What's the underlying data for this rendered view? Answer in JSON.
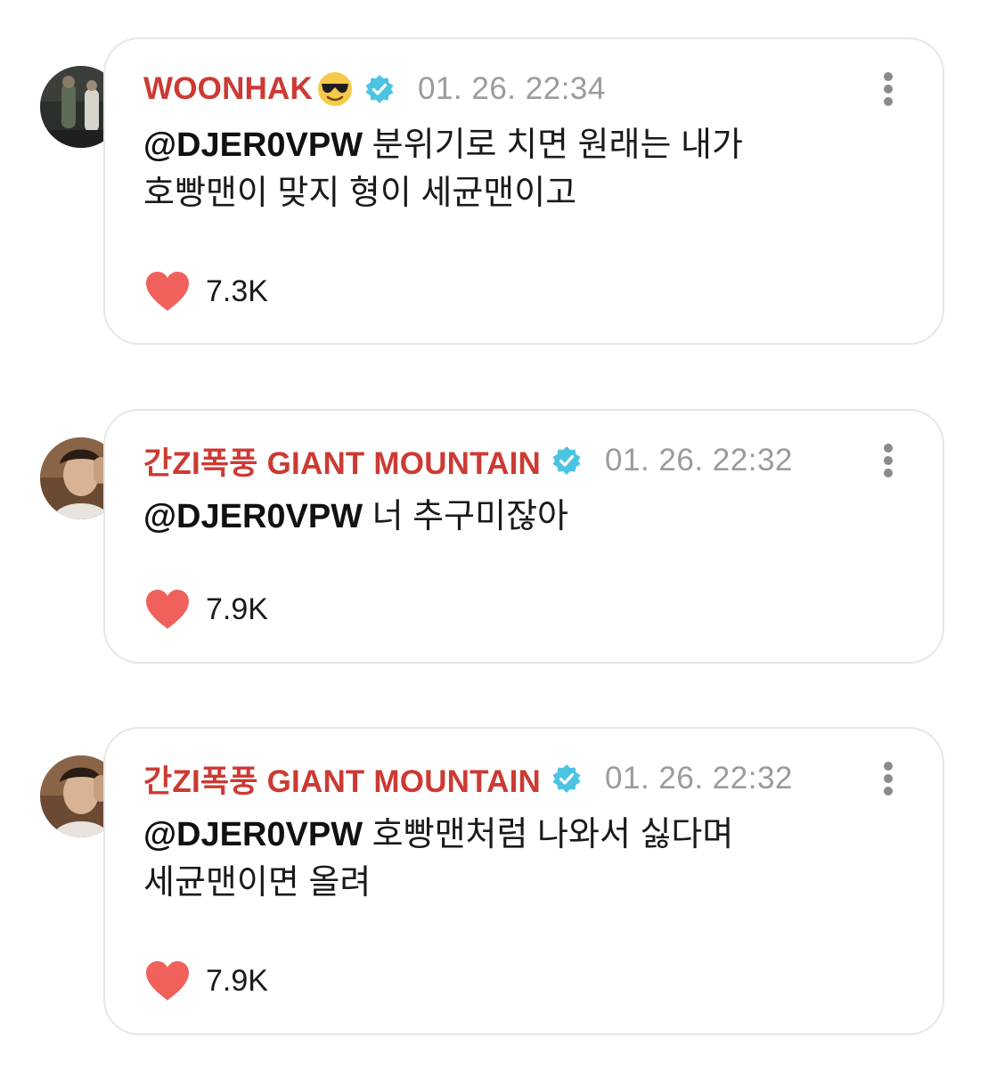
{
  "comments": [
    {
      "author": "WOONHAK",
      "has_emoji": true,
      "emoji": "sunglasses-emoji",
      "verified": true,
      "time": "01. 26. 22:34",
      "mention": "@DJER0VPW",
      "text_line1": " 분위기로 치면 원래는 내가",
      "text_line2": "호빵맨이 맞지 형이 세균맨이고",
      "likes": "7.3K"
    },
    {
      "author": "간ZI폭풍 GIANT MOUNTAIN",
      "has_emoji": false,
      "verified": true,
      "time": "01. 26. 22:32",
      "mention": "@DJER0VPW",
      "text_line1": " 너 추구미잖아",
      "text_line2": "",
      "likes": "7.9K"
    },
    {
      "author": "간ZI폭풍 GIANT MOUNTAIN",
      "has_emoji": false,
      "verified": true,
      "time": "01. 26. 22:32",
      "mention": "@DJER0VPW",
      "text_line1": " 호빵맨처럼 나와서 싫다며",
      "text_line2": "세균맨이면 올려",
      "likes": "7.9K"
    }
  ],
  "colors": {
    "author": "#cc3a33",
    "time": "#9b9b9b",
    "heart": "#f0615c",
    "verified_badge": "#4cc3e3",
    "card_border": "#e6e6e6"
  }
}
